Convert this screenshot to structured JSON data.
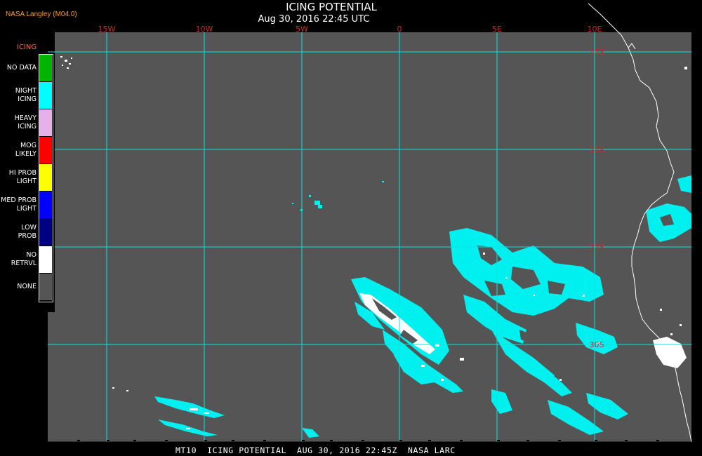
{
  "header": {
    "credit": "NASA Langley (M04.0)",
    "title": "ICING POTENTIAL",
    "subtitle": "Aug 30, 2016 22:45 UTC"
  },
  "footer": {
    "text": "MT10  ICING POTENTIAL  AUG 30, 2016 22:45Z  NASA LARC"
  },
  "legend": {
    "title": "ICING",
    "items": [
      {
        "label": "NO DATA",
        "color": "#00b400"
      },
      {
        "label": "NIGHT ICING",
        "color": "#00ffff"
      },
      {
        "label": "HEAVY ICING",
        "color": "#e8b0e8"
      },
      {
        "label": "MOG LIKELY",
        "color": "#ff0000"
      },
      {
        "label": "HI PROB LIGHT",
        "color": "#ffff00"
      },
      {
        "label": "MED PROB LIGHT",
        "color": "#0000ff"
      },
      {
        "label": "LOW PROB",
        "color": "#000080"
      },
      {
        "label": "NO RETRVL",
        "color": "#ffffff"
      },
      {
        "label": "NONE",
        "color": "#555555"
      }
    ]
  },
  "map": {
    "background_color": "#555555",
    "grid_color": "#00e5e5",
    "longitude_labels": [
      "15W",
      "10W",
      "5W",
      "0",
      "5E",
      "10E"
    ],
    "latitude_labels": [
      "15S",
      "20S",
      "25S",
      "30S"
    ],
    "label_color": "#cc2a2a",
    "coastline_color": "#ffffff"
  }
}
